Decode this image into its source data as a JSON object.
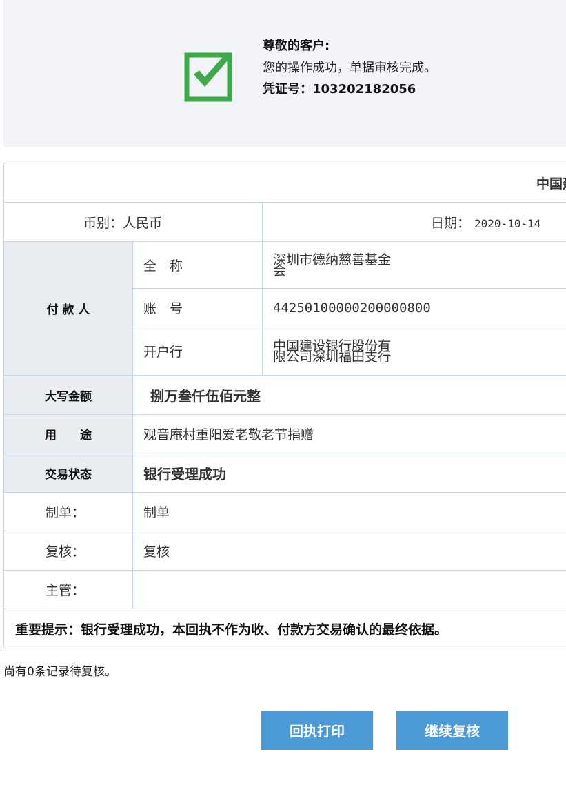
{
  "notice": {
    "greeting": "尊敬的客户:",
    "message": "您的操作成功，单据审核完成。",
    "voucher_label": "凭证号：",
    "voucher_number": "103202182056"
  },
  "receipt": {
    "title": "中国建",
    "currency_label": "币别：",
    "currency_value": "人民币",
    "date_label": "日期：",
    "date_value": "2020-10-14",
    "payer_label": "付 款 人",
    "full_name_label": "全　称",
    "full_name_value": "深圳市德纳慈善基金会",
    "account_label": "账　号",
    "account_value": "44250100000200000800",
    "bank_label": "开户行",
    "bank_value": "中国建设银行股份有限公司深圳福田支行",
    "amount_label": "大写金额",
    "amount_value": "捌万叁仟伍佰元整",
    "purpose_label": "用　　途",
    "purpose_value": "观音庵村重阳爱老敬老节捐赠",
    "status_label": "交易状态",
    "status_value": "银行受理成功",
    "maker_label": "制单：",
    "maker_value": "制单",
    "checker_label": "复核：",
    "checker_value": "复核",
    "supervisor_label": "主管：",
    "supervisor_value": "",
    "important_notice": "重要提示：银行受理成功，本回执不作为收、付款方交易确认的最终依据。"
  },
  "pending_text": "尚有0条记录待复核。",
  "buttons": {
    "print_label": "回执打印",
    "continue_label": "继续复核"
  },
  "colors": {
    "accent": "#4b9ad6",
    "success": "#3ca94a",
    "label_bg": "#e9edf2",
    "border": "#c6d6e8"
  }
}
